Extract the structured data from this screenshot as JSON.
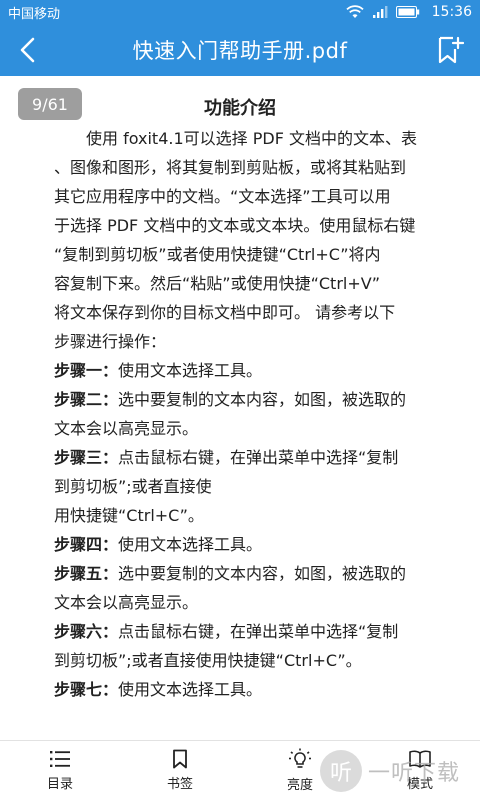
{
  "status_bar": {
    "carrier": "中国移动",
    "time": "15:36"
  },
  "app_bar": {
    "title": "快速入门帮助手册.pdf"
  },
  "document": {
    "page_indicator": "9/61",
    "title": "功能介绍",
    "lines": [
      {
        "label": "",
        "text": "　　使用 foxit4.1可以选择  PDF 文档中的文本、表"
      },
      {
        "label": "",
        "text": "、图像和图形，将其复制到剪贴板，或将其粘贴到"
      },
      {
        "label": "",
        "text": "其它应用程序中的文档。“文本选择”工具可以用"
      },
      {
        "label": "",
        "text": "于选择 PDF 文档中的文本或文本块。使用鼠标右键"
      },
      {
        "label": "",
        "text": "“复制到剪切板”或者使用快捷键“Ctrl+C”将内"
      },
      {
        "label": "",
        "text": "容复制下来。然后“粘贴”或使用快捷“Ctrl+V”"
      },
      {
        "label": "",
        "text": "将文本保存到你的目标文档中即可。    请参考以下"
      },
      {
        "label": "",
        "text": "步骤进行操作："
      },
      {
        "label": "步骤一：",
        "text": "使用文本选择工具。"
      },
      {
        "label": "步骤二：",
        "text": "选中要复制的文本内容，如图，被选取的"
      },
      {
        "label": "",
        "text": "文本会以高亮显示。"
      },
      {
        "label": "步骤三：",
        "text": "点击鼠标右键，在弹出菜单中选择“复制"
      },
      {
        "label": "",
        "text": "到剪切板”;或者直接使"
      },
      {
        "label": "",
        "text": "用快捷键“Ctrl+C”。"
      },
      {
        "label": "步骤四：",
        "text": "使用文本选择工具。"
      },
      {
        "label": "步骤五：",
        "text": "选中要复制的文本内容，如图，被选取的"
      },
      {
        "label": "",
        "text": "文本会以高亮显示。"
      },
      {
        "label": "步骤六：",
        "text": "点击鼠标右键，在弹出菜单中选择“复制"
      },
      {
        "label": "",
        "text": "到剪切板”;或者直接使用快捷键“Ctrl+C”。"
      },
      {
        "label": "步骤七：",
        "text": "使用文本选择工具。"
      }
    ]
  },
  "bottom_bar": {
    "items": [
      {
        "label": "目录",
        "icon": "list-icon"
      },
      {
        "label": "书签",
        "icon": "bookmark-icon"
      },
      {
        "label": "亮度",
        "icon": "lightbulb-icon"
      },
      {
        "label": "模式",
        "icon": "book-icon"
      }
    ]
  },
  "watermark": {
    "badge": "听",
    "text": "一听下载"
  },
  "colors": {
    "accent": "#2f8fdc",
    "page_indicator_bg": "#9e9e9e"
  }
}
